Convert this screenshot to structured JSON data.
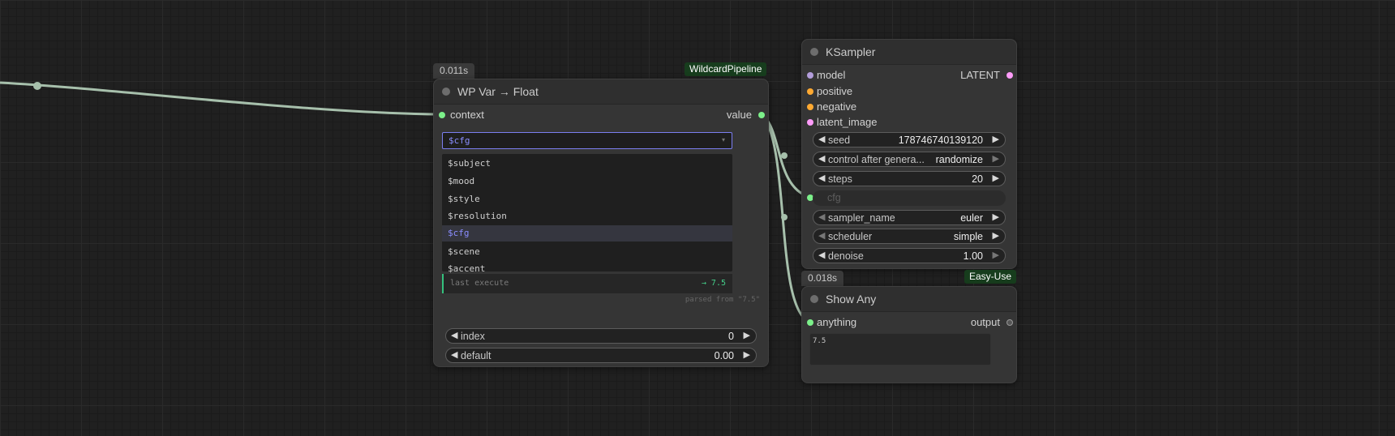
{
  "colors": {
    "canvas": "#202020",
    "node_body": "#353535",
    "link": "#a7c0ac",
    "slot_context": "#7cf08a",
    "slot_model": "#b39ddb",
    "slot_conditioning": "#ffa931",
    "slot_latent": "#ff9cf9",
    "selected_text": "#8a8dff",
    "exec_accent": "#34c17d"
  },
  "wp_node": {
    "exec_time": "0.011s",
    "group_badge": "WildcardPipeline",
    "title": "WP Var → Float",
    "input_context": "context",
    "output_value": "value",
    "combo_value": "$cfg",
    "options": [
      "$subject",
      "$mood",
      "$style",
      "$resolution",
      "$cfg",
      "$scene",
      "$accent"
    ],
    "selected_option": "$cfg",
    "last_execute_label": "last execute",
    "last_execute_value": "→ 7.5",
    "parsed_note": "parsed from \"7.5\"",
    "widgets": [
      {
        "label": "index",
        "value": "0"
      },
      {
        "label": "default",
        "value": "0.00"
      }
    ]
  },
  "ksampler": {
    "title": "KSampler",
    "inputs": [
      {
        "name": "model",
        "color_key": "slot_model"
      },
      {
        "name": "positive",
        "color_key": "slot_conditioning"
      },
      {
        "name": "negative",
        "color_key": "slot_conditioning"
      },
      {
        "name": "latent_image",
        "color_key": "slot_latent"
      }
    ],
    "output": "LATENT",
    "widgets": [
      {
        "label": "seed",
        "value": "178746740139120"
      },
      {
        "label": "control after genera...",
        "value": "randomize"
      },
      {
        "label": "steps",
        "value": "20"
      },
      {
        "label": "cfg",
        "value": "",
        "disabled": true
      },
      {
        "label": "sampler_name",
        "value": "euler"
      },
      {
        "label": "scheduler",
        "value": "simple"
      },
      {
        "label": "denoise",
        "value": "1.00"
      }
    ]
  },
  "show_any": {
    "exec_time": "0.018s",
    "group_badge": "Easy-Use",
    "title": "Show Any",
    "input": "anything",
    "output": "output",
    "text": "7.5"
  }
}
